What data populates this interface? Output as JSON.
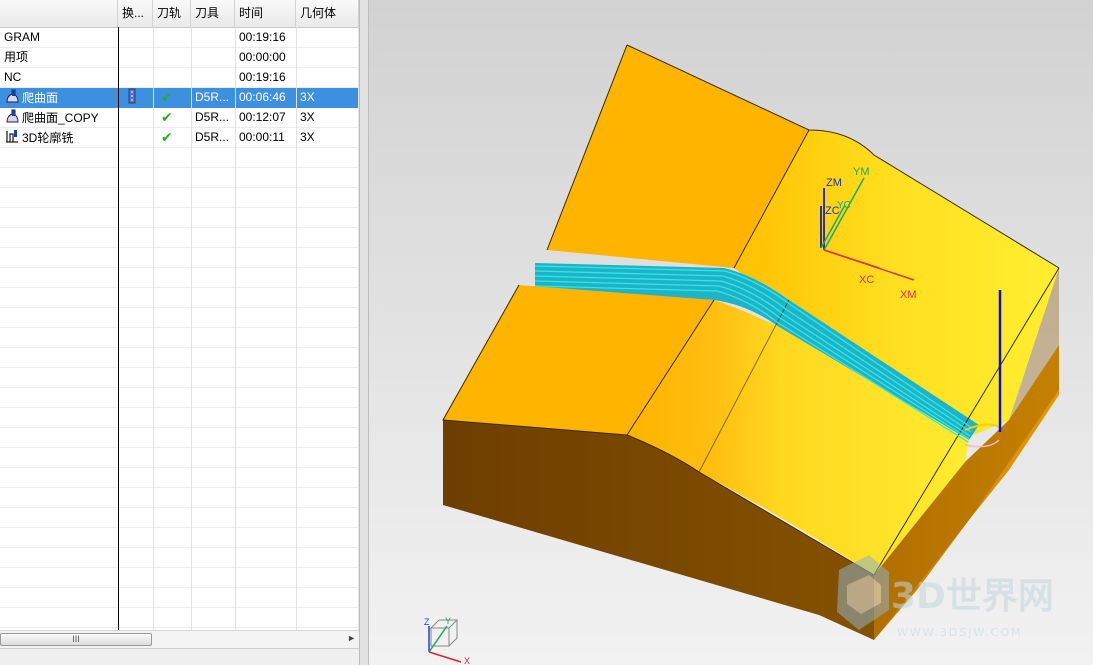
{
  "navigator": {
    "columns": [
      {
        "label": "",
        "name": "col-name"
      },
      {
        "label": "换...",
        "name": "col-toolchange"
      },
      {
        "label": "刀轨",
        "name": "col-toolpath"
      },
      {
        "label": "刀具",
        "name": "col-tool"
      },
      {
        "label": "时间",
        "name": "col-time"
      },
      {
        "label": "几何体",
        "name": "col-geometry"
      }
    ],
    "rows": [
      {
        "name": "GRAM",
        "icon": "",
        "toolchange": "",
        "path": "",
        "tool": "",
        "time": "00:19:16",
        "geom": "",
        "selected": false
      },
      {
        "name": "用项",
        "icon": "",
        "toolchange": "",
        "path": "",
        "tool": "",
        "time": "00:00:00",
        "geom": "",
        "selected": false
      },
      {
        "name": "NC",
        "icon": "",
        "toolchange": "",
        "path": "",
        "tool": "",
        "time": "00:19:16",
        "geom": "",
        "selected": false
      },
      {
        "name": "爬曲面",
        "icon": "contour-area-operation-icon",
        "toolchange": "tool-change-icon",
        "path": "✔",
        "tool": "D5R...",
        "time": "00:06:46",
        "geom": "3X",
        "selected": true
      },
      {
        "name": "爬曲面_COPY",
        "icon": "contour-area-operation-icon",
        "toolchange": "",
        "path": "✔",
        "tool": "D5R...",
        "time": "00:12:07",
        "geom": "3X",
        "selected": false
      },
      {
        "name": "3D轮廓铣",
        "icon": "profile-3d-operation-icon",
        "toolchange": "",
        "path": "✔",
        "tool": "D5R...",
        "time": "00:00:11",
        "geom": "3X",
        "selected": false
      }
    ],
    "empty_rows": 24,
    "scroll_thumb_label": "III"
  },
  "viewport": {
    "csys_labels": {
      "zm": "ZM",
      "ym": "YM",
      "zc": "ZC",
      "yc": "YC",
      "xc": "XC",
      "xm": "XM"
    },
    "triad_labels": {
      "z": "Z",
      "y": "Y",
      "x": "X"
    },
    "part_colors": {
      "top_light": "#FFE82A",
      "top_orange": "#FFB400",
      "side": "#7A4A00",
      "toolpath": "#2FE0E0",
      "tool_axis": "#1010CC"
    }
  },
  "watermark": {
    "logo_text": "3D世界网",
    "url_text": "WWW.3DSJW.COM"
  }
}
